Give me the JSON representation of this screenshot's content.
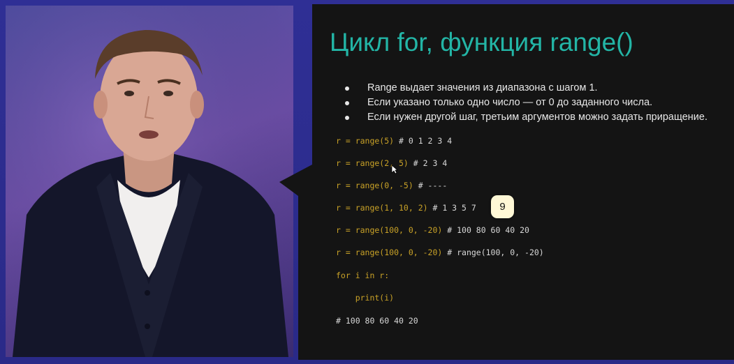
{
  "slide": {
    "title": "Цикл for, функция range()",
    "bullets": [
      "Range выдает значения из диапазона с шагом 1.",
      "Если указано только одно число — от 0 до заданного числа.",
      "Если нужен другой шаг, третьим аргументов можно задать приращение."
    ],
    "code_lines": [
      {
        "code": "r = range(5) ",
        "comment": "# 0 1 2 3 4"
      },
      {
        "code": "r = range(2, 5) ",
        "comment": "# 2 3 4"
      },
      {
        "code": "r = range(0, -5) ",
        "comment": "# ----"
      },
      {
        "code": "r = range(1, 10, 2) ",
        "comment": "# 1 3 5 7"
      },
      {
        "code": "r = range(100, 0, -20) ",
        "comment": "# 100 80 60 40 20"
      },
      {
        "code": "r = range(100, 0, -20) ",
        "comment": "# range(100, 0, -20)"
      },
      {
        "code": "for i in r:",
        "comment": ""
      },
      {
        "code": "    print(i)",
        "comment": ""
      },
      {
        "code": "",
        "comment": "# 100 80 60 40 20"
      }
    ]
  },
  "badge": {
    "value": "9"
  },
  "colors": {
    "background": "#2a2d8c",
    "slide_bg": "#141414",
    "title": "#23b5a6",
    "code": "#c9a227",
    "comment": "#d8d8d8",
    "badge_bg": "#fff8d6"
  },
  "icons": {
    "cursor": "mouse-pointer-icon"
  }
}
